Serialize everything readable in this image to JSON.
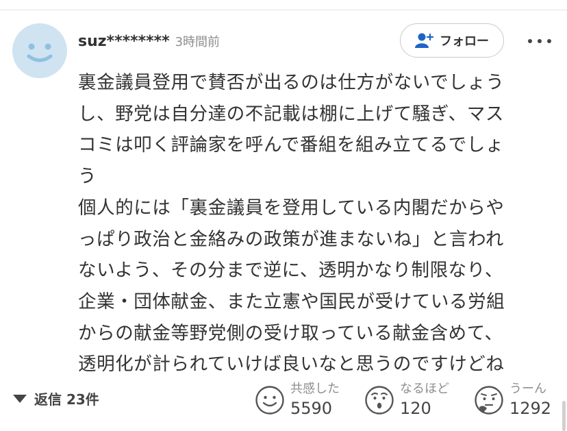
{
  "comment": {
    "username": "suz********",
    "time": "3時間前",
    "follow_label": "フォロー",
    "lines": [
      "裏金議員登用で賛否が出るのは仕方がないでしょう",
      "し、野党は自分達の不記載は棚に上げて騒ぎ、マス",
      "コミは叩く評論家を呼んで番組を組み立てるでしょ",
      "う",
      "個人的には「裏金議員を登用している内閣だからや",
      "っぱり政治と金絡みの政策が進まないね」と言われ",
      "ないよう、その分まで逆に、透明かなり制限なり、",
      "企業・団体献金、また立憲や国民が受けている労組",
      "からの献金等野党側の受け取っている献金含めて、",
      "透明化が計られていけば良いなと思うのですけどね"
    ]
  },
  "footer": {
    "replies_label": "返信 23件",
    "reactions": [
      {
        "label": "共感した",
        "count": "5590",
        "icon": "smile-face-icon"
      },
      {
        "label": "なるほど",
        "count": "120",
        "icon": "surprised-face-icon"
      },
      {
        "label": "うーん",
        "count": "1292",
        "icon": "thinking-face-icon"
      }
    ]
  },
  "colors": {
    "avatar_bg": "#cfe3f1",
    "avatar_face": "#8fc1e0",
    "follow_icon": "#1e64c8",
    "text": "#333333",
    "muted": "#8e8e8e"
  }
}
